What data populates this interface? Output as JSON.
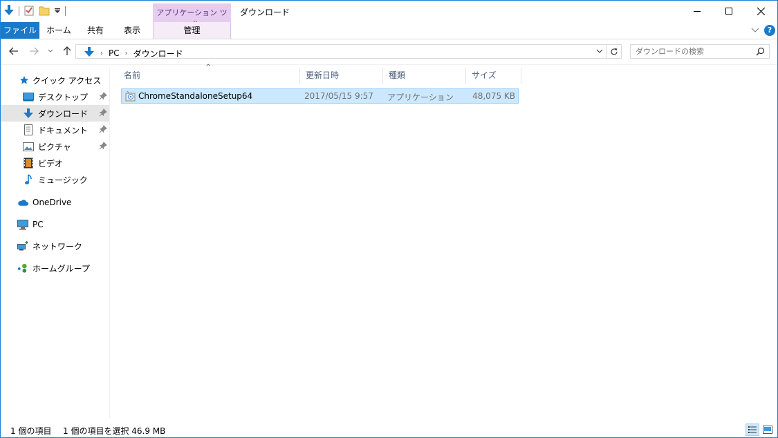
{
  "window": {
    "title": "ダウンロード",
    "context_tab_title": "アプリケーション ツール"
  },
  "ribbon": {
    "tabs": [
      {
        "label": "ファイル"
      },
      {
        "label": "ホーム"
      },
      {
        "label": "共有"
      },
      {
        "label": "表示"
      },
      {
        "label": "管理"
      }
    ],
    "help_label": "?"
  },
  "address": {
    "crumbs": [
      "PC",
      "ダウンロード"
    ]
  },
  "search": {
    "placeholder": "ダウンロードの検索"
  },
  "navpane": {
    "quick_access": "クイック アクセス",
    "items": [
      {
        "label": "デスクトップ"
      },
      {
        "label": "ダウンロード"
      },
      {
        "label": "ドキュメント"
      },
      {
        "label": "ピクチャ"
      },
      {
        "label": "ビデオ"
      },
      {
        "label": "ミュージック"
      }
    ],
    "onedrive": "OneDrive",
    "pc": "PC",
    "network": "ネットワーク",
    "homegroup": "ホームグループ"
  },
  "columns": {
    "name": "名前",
    "date": "更新日時",
    "type": "種類",
    "size": "サイズ"
  },
  "files": [
    {
      "name": "ChromeStandaloneSetup64",
      "date": "2017/05/15 9:57",
      "type": "アプリケーション",
      "size": "48,075 KB"
    }
  ],
  "status": {
    "count": "1 個の項目",
    "selected": "1 個の項目を選択  46.9 MB"
  },
  "colors": {
    "accent": "#1979ca",
    "selection": "#cce8ff",
    "context_tab": "#e6cdf0"
  }
}
